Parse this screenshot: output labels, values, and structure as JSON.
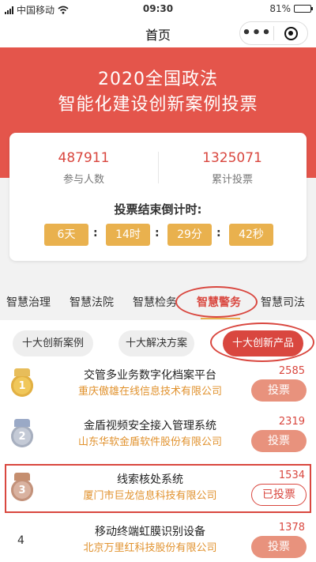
{
  "status_bar": {
    "carrier": "中国移动",
    "time": "09:30",
    "battery": "81%",
    "battery_level": 0.81
  },
  "nav": {
    "title": "首页",
    "more_icon": "more-dots-icon",
    "close_icon": "target-icon"
  },
  "banner": {
    "line1": "2020全国政法",
    "line2": "智能化建设创新案例投票"
  },
  "stats": [
    {
      "value": "487911",
      "label": "参与人数"
    },
    {
      "value": "1325071",
      "label": "累计投票"
    }
  ],
  "countdown": {
    "title": "投票结束倒计时:",
    "units": [
      "6天",
      "14时",
      "29分",
      "42秒"
    ],
    "separator": ":"
  },
  "tabs": [
    "智慧治理",
    "智慧法院",
    "智慧检务",
    "智慧警务",
    "智慧司法"
  ],
  "active_tab": "智慧警务",
  "categories": [
    "十大创新案例",
    "十大解决方案",
    "十大创新产品"
  ],
  "active_category": "十大创新产品",
  "items": [
    {
      "rank": "1",
      "name": "交管多业务数字化档案平台",
      "company": "重庆傲雄在线信息技术有限公司",
      "votes": "2585",
      "button": "投票"
    },
    {
      "rank": "2",
      "name": "金盾视频安全接入管理系统",
      "company": "山东华软金盾软件股份有限公司",
      "votes": "2319",
      "button": "投票"
    },
    {
      "rank": "3",
      "name": "线索核处系统",
      "company": "厦门市巨龙信息科技有限公司",
      "votes": "1534",
      "button": "已投票"
    },
    {
      "rank": "4",
      "name": "移动终端虹膜识别设备",
      "company": "北京万里红科技股份有限公司",
      "votes": "1378",
      "button": "投票"
    }
  ],
  "colors": {
    "primary_red": "#d9473f",
    "banner": "#e4554b",
    "gold": "#e9b14e",
    "company_text": "#e1922e"
  }
}
